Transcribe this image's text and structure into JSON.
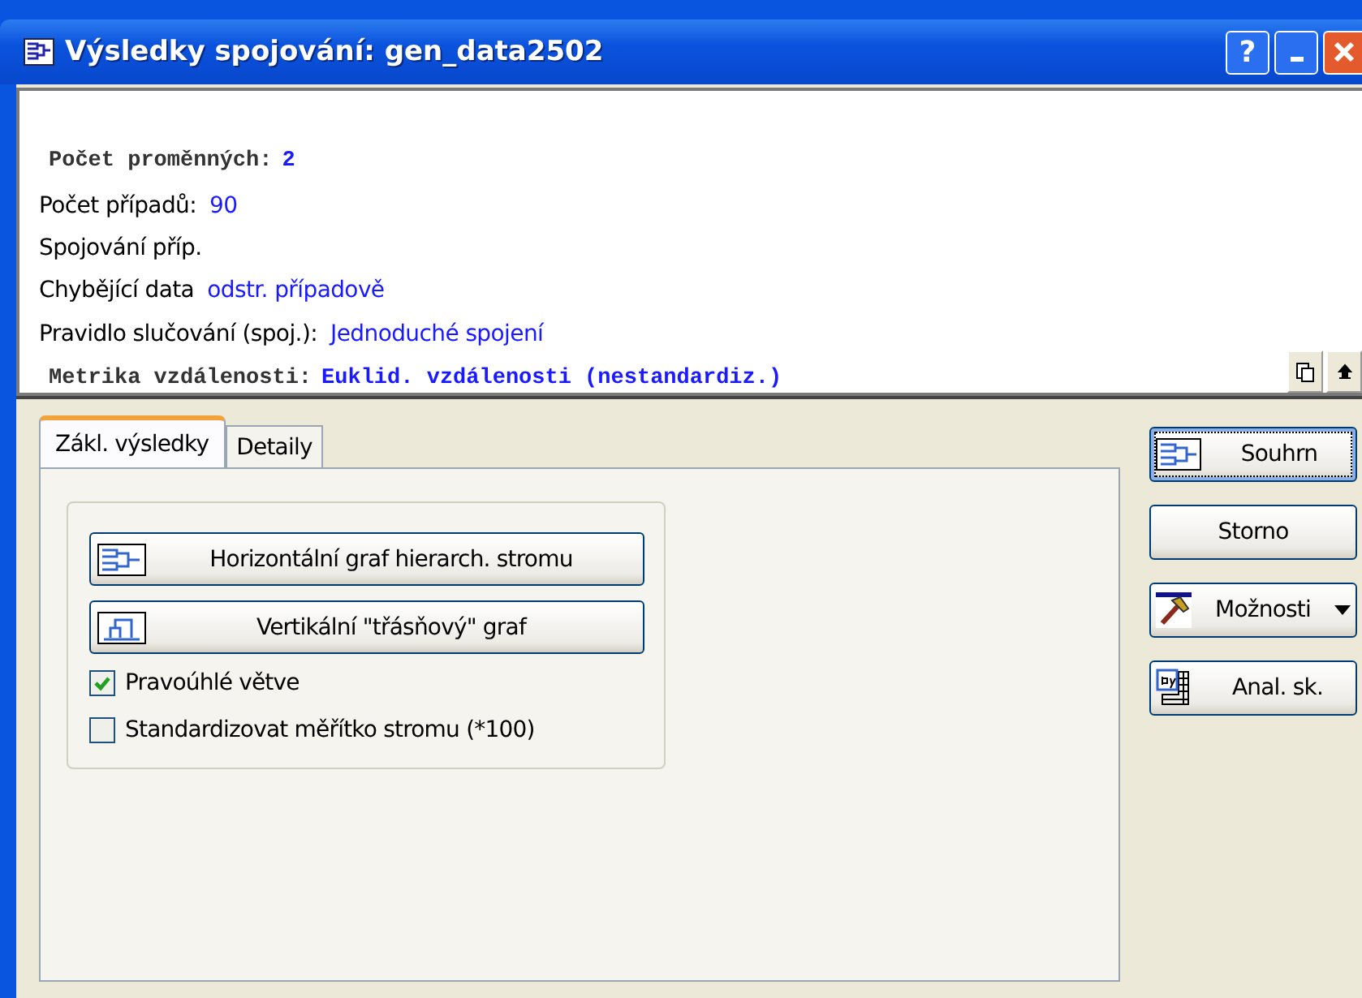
{
  "window": {
    "title": "Výsledky spojování: gen_data2502",
    "help_label": "?"
  },
  "summary": [
    {
      "kind": "mono",
      "label": "Počet proměnných:",
      "value": "2"
    },
    {
      "kind": "sans",
      "label": "Počet případů:",
      "value": "90"
    },
    {
      "kind": "sans",
      "label": "Spojování příp."
    },
    {
      "kind": "sans",
      "label": "Chybějící data",
      "value": "odstr. případově"
    },
    {
      "kind": "sans",
      "label": "Pravidlo slučování (spoj.):",
      "value": "Jednoduché spojení"
    },
    {
      "kind": "mono",
      "label": "Metrika vzdálenosti:",
      "value": "Euklid. vzdálenosti (nestandardiz.)"
    }
  ],
  "tabs": [
    {
      "label": "Zákl. výsledky",
      "selected": true
    },
    {
      "label": "Detaily",
      "selected": false
    }
  ],
  "graph_buttons": [
    {
      "kind": "horizontal",
      "label": "Horizontální graf hierarch. stromu"
    },
    {
      "kind": "vertical",
      "label": "Vertikální \"třásňový\" graf"
    }
  ],
  "options": [
    {
      "label": "Pravoúhlé větve",
      "checked": true
    },
    {
      "label": "Standardizovat měřítko stromu (*100)",
      "checked": false
    }
  ],
  "side_buttons": [
    {
      "kind": "tree",
      "label": "Souhrn",
      "focused": true
    },
    {
      "kind": "plain",
      "label": "Storno",
      "focused": false
    },
    {
      "kind": "hammer",
      "label": "Možnosti",
      "focused": false,
      "dropdown": true
    },
    {
      "kind": "table",
      "label": "Anal. sk.",
      "focused": false
    }
  ]
}
